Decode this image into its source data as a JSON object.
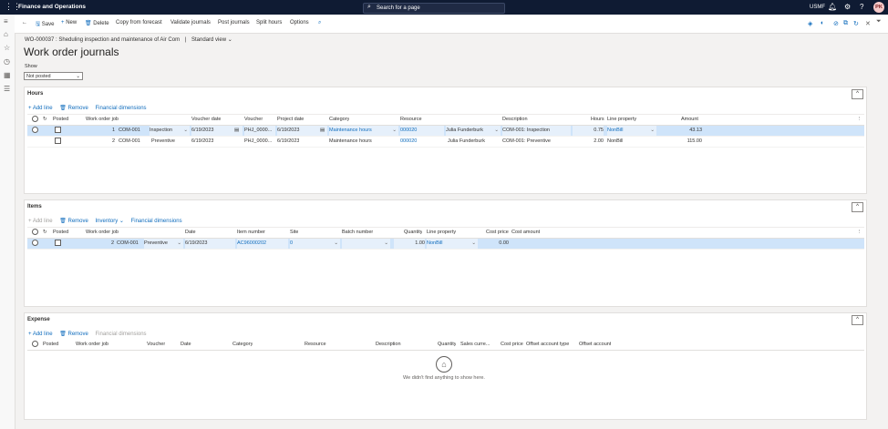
{
  "topbar": {
    "app_name": "Finance and Operations",
    "search_placeholder": "Search for a page",
    "company": "USMF",
    "user_initials": "PK"
  },
  "actionbar": {
    "save": "Save",
    "new": "New",
    "delete": "Delete",
    "copy_from_forecast": "Copy from forecast",
    "validate_journals": "Validate journals",
    "post_journals": "Post journals",
    "split_hours": "Split hours",
    "options": "Options"
  },
  "page": {
    "breadcrumb": "WO-000037 : Sheduling inspection and maintenance of Air Com",
    "view": "Standard view",
    "title": "Work order journals",
    "show_label": "Show",
    "show_value": "Not posted"
  },
  "hours": {
    "title": "Hours",
    "toolbar": {
      "add_line": "Add line",
      "remove": "Remove",
      "financial_dimensions": "Financial dimensions"
    },
    "columns": [
      "Posted",
      "Work order job",
      "Voucher date",
      "Voucher",
      "Project date",
      "Category",
      "Resource",
      "Description",
      "Hours",
      "Line property",
      "Amount"
    ],
    "rows": [
      {
        "job_no": "1",
        "job": "COM-001",
        "job_type": "Inspection",
        "voucher_date": "6/19/2023",
        "voucher": "PHJ_0000...",
        "project_date": "6/19/2023",
        "category": "Maintenance hours",
        "resource": "000020",
        "resource_name": "Julia Funderburk",
        "description": "COM-001: Inspection",
        "hours": "0.75",
        "line_property": "NonBill",
        "amount": "43.13"
      },
      {
        "job_no": "2",
        "job": "COM-001",
        "job_type": "Preventive",
        "voucher_date": "6/19/2023",
        "voucher": "PHJ_0000...",
        "project_date": "6/19/2023",
        "category": "Maintenance hours",
        "resource": "000020",
        "resource_name": "Julia Funderburk",
        "description": "COM-001: Preventive",
        "hours": "2.00",
        "line_property": "NonBill",
        "amount": "115.00"
      }
    ]
  },
  "items": {
    "title": "Items",
    "toolbar": {
      "add_line": "Add line",
      "remove": "Remove",
      "inventory": "Inventory",
      "financial_dimensions": "Financial dimensions"
    },
    "columns": [
      "Posted",
      "Work order job",
      "Date",
      "Item number",
      "Site",
      "Batch number",
      "Quantity",
      "Line property",
      "Cost price",
      "Cost amount"
    ],
    "rows": [
      {
        "job_no": "2",
        "job": "COM-001",
        "job_type": "Preventive",
        "date": "6/19/2023",
        "item_number": "AC96000202",
        "site": "0",
        "batch": "",
        "quantity": "1.00",
        "line_property": "NonBill",
        "cost_price": "0.00",
        "cost_amount": ""
      }
    ]
  },
  "expense": {
    "title": "Expense",
    "toolbar": {
      "add_line": "Add line",
      "remove": "Remove",
      "financial_dimensions": "Financial dimensions"
    },
    "columns": [
      "Posted",
      "Work order job",
      "Voucher",
      "Date",
      "Category",
      "Resource",
      "Description",
      "Quantity",
      "Sales curre...",
      "Cost price",
      "Offset account type",
      "Offset account"
    ],
    "empty_message": "We didn't find anything to show here."
  }
}
